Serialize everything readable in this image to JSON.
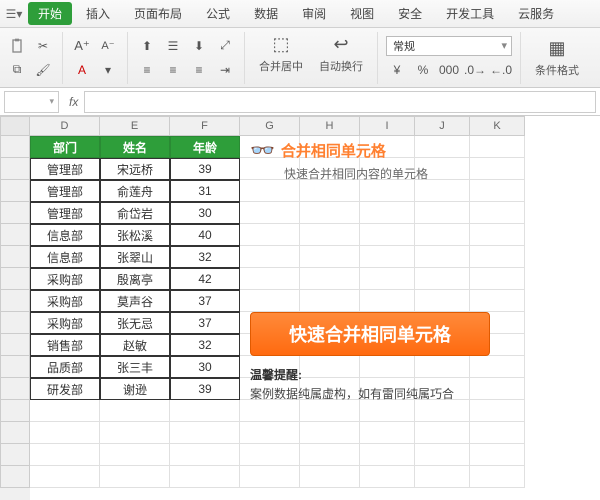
{
  "menu": {
    "tabs": [
      "开始",
      "插入",
      "页面布局",
      "公式",
      "数据",
      "审阅",
      "视图",
      "安全",
      "开发工具",
      "云服务"
    ],
    "active": 0
  },
  "ribbon": {
    "merge": "合并居中",
    "wrap": "自动换行",
    "numfmt": "常规",
    "condfmt": "条件格式"
  },
  "fxlabel": "fx",
  "cols": [
    "D",
    "E",
    "F",
    "G",
    "H",
    "I",
    "J",
    "K"
  ],
  "table": {
    "headers": [
      "部门",
      "姓名",
      "年龄"
    ],
    "rows": [
      [
        "管理部",
        "宋远桥",
        "39"
      ],
      [
        "管理部",
        "俞莲舟",
        "31"
      ],
      [
        "管理部",
        "俞岱岩",
        "30"
      ],
      [
        "信息部",
        "张松溪",
        "40"
      ],
      [
        "信息部",
        "张翠山",
        "32"
      ],
      [
        "采购部",
        "殷离亭",
        "42"
      ],
      [
        "采购部",
        "莫声谷",
        "37"
      ],
      [
        "采购部",
        "张无忌",
        "37"
      ],
      [
        "销售部",
        "赵敏",
        "32"
      ],
      [
        "品质部",
        "张三丰",
        "30"
      ],
      [
        "研发部",
        "谢逊",
        "39"
      ]
    ]
  },
  "overlay": {
    "title": "合并相同单元格",
    "sub": "快速合并相同内容的单元格",
    "button": "快速合并相同单元格",
    "warn": "温馨提醒:",
    "warntxt": "案例数据纯属虚构，如有雷同纯属巧合"
  },
  "colors": {
    "accent": "#2e9e3a",
    "orange": "#ff7a20"
  }
}
